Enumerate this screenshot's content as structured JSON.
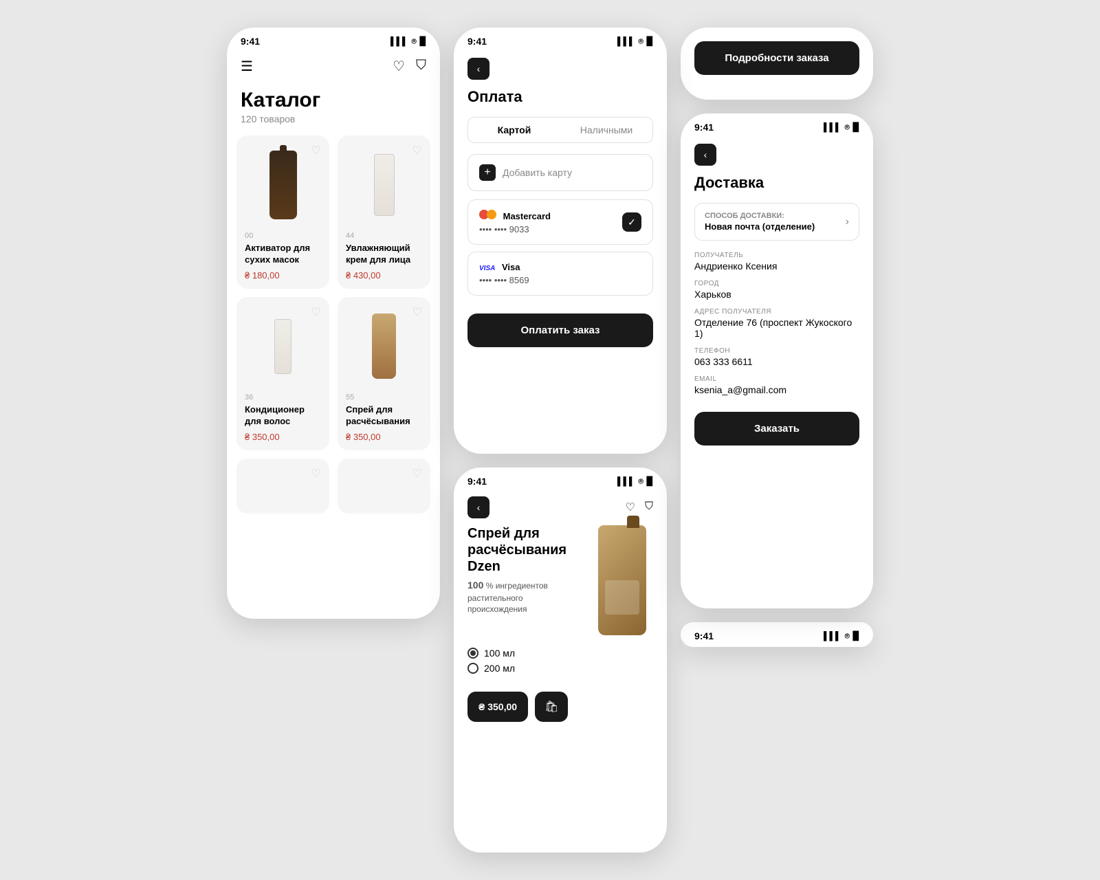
{
  "screen1": {
    "statusBar": {
      "time": "9:41"
    },
    "catalogTitle": "Каталог",
    "catalogCount": "120 товаров",
    "products": [
      {
        "number": "00",
        "name": "Активатор для сухих масок",
        "price": "₴ 180,00"
      },
      {
        "number": "44",
        "name": "Увлажняющий крем для лица",
        "price": "₴ 430,00"
      },
      {
        "number": "36",
        "name": "Кондиционер для волос",
        "price": "₴ 350,00"
      },
      {
        "number": "55",
        "name": "Спрей для расчёсывания",
        "price": "₴ 350,00"
      }
    ]
  },
  "screen2": {
    "statusBar": {
      "time": "9:41"
    },
    "title": "Оплата",
    "tabs": [
      {
        "label": "Картой",
        "active": true
      },
      {
        "label": "Наличными",
        "active": false
      }
    ],
    "addCardLabel": "Добавить карту",
    "cards": [
      {
        "brand": "Mastercard",
        "brandType": "mastercard",
        "dots": "•••• ••••",
        "last4": "9033",
        "selected": true
      },
      {
        "brand": "Visa",
        "brandType": "visa",
        "dots": "•••• ••••",
        "last4": "8569",
        "selected": false
      }
    ],
    "payButtonLabel": "Оплатить заказ"
  },
  "screen3": {
    "statusBar": {
      "time": "9:41"
    },
    "productName": "Спрей для расчёсывания Dzen",
    "ingredientPercent": "100",
    "ingredientText": "% ингредиентов растительного происхождения",
    "sizes": [
      {
        "label": "100 мл",
        "selected": true
      },
      {
        "label": "200 мл",
        "selected": false
      }
    ],
    "price": "₴ 350,00"
  },
  "screen4": {
    "statusBar": {
      "time": "9:41"
    },
    "title": "Доставка",
    "deliveryMethodLabel": "Способ доставки:",
    "deliveryMethodValue": "Новая почта (отделение)",
    "fields": [
      {
        "label": "ПОЛУЧАТЕЛЬ",
        "value": "Андриенко Ксения"
      },
      {
        "label": "ГОРОД",
        "value": "Харьков"
      },
      {
        "label": "АДРЕС ПОЛУЧАТЕЛЯ",
        "value": "Отделение 76 (проспект Жукоского 1)"
      },
      {
        "label": "ТЕЛЕФОН",
        "value": "063 333 6611"
      },
      {
        "label": "EMAIL",
        "value": "ksenia_a@gmail.com"
      }
    ],
    "orderDetailsButtonLabel": "Подробности заказа",
    "orderButtonLabel": "Заказать"
  }
}
